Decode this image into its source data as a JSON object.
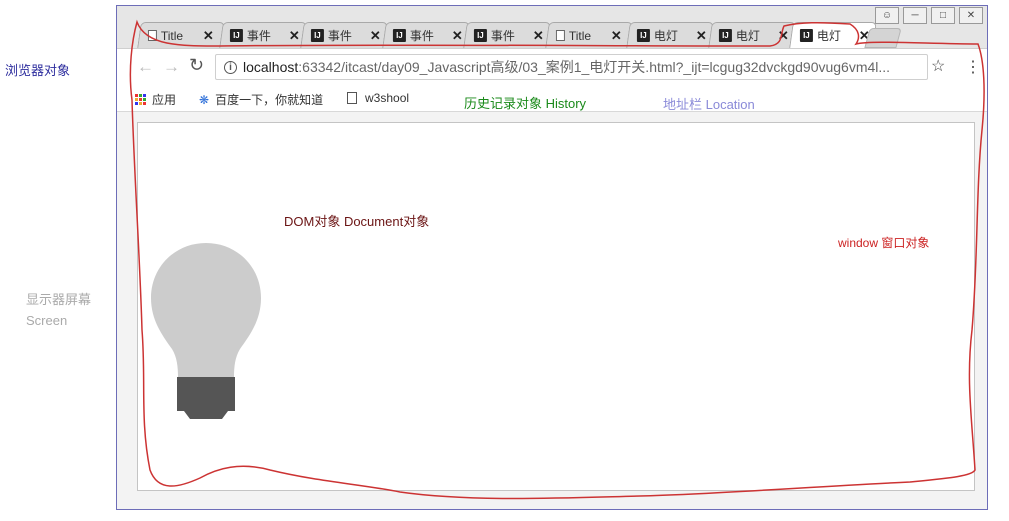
{
  "labels": {
    "browser_object": "浏览器对象",
    "screen_object": "显示器屏幕\nScreen"
  },
  "tabs": [
    {
      "icon": "page-icon",
      "title": "Title"
    },
    {
      "icon": "intellij-icon",
      "title": "事件"
    },
    {
      "icon": "intellij-icon",
      "title": "事件"
    },
    {
      "icon": "intellij-icon",
      "title": "事件"
    },
    {
      "icon": "intellij-icon",
      "title": "事件"
    },
    {
      "icon": "page-icon",
      "title": "Title"
    },
    {
      "icon": "intellij-icon",
      "title": "电灯"
    },
    {
      "icon": "intellij-icon",
      "title": "电灯"
    },
    {
      "icon": "intellij-icon",
      "title": "电灯",
      "active": true
    }
  ],
  "tab_close": "✕",
  "window_controls": [
    "⍝",
    "▭",
    "▣",
    "✕"
  ],
  "toolbar": {
    "back": "←",
    "forward": "→",
    "reload": "↻",
    "url_host": "localhost",
    "url_rest": ":63342/itcast/day09_Javascript高级/03_案例1_电灯开关.html?_ijt=lcgug32dvckgd90vug6vm4l...",
    "star": "☆",
    "menu": "⋮"
  },
  "bookmarks": {
    "apps": "应用",
    "baidu": "百度一下，你就知道",
    "w3": "w3shool"
  },
  "annotations": {
    "history": "历史记录对象 History",
    "location": "地址栏 Location",
    "dom": "DOM对象 Document对象",
    "window": "window 窗口对象"
  },
  "colors": {
    "bulb_glass": "#cccccc",
    "bulb_base": "#555555",
    "outline": "#cc3333"
  }
}
